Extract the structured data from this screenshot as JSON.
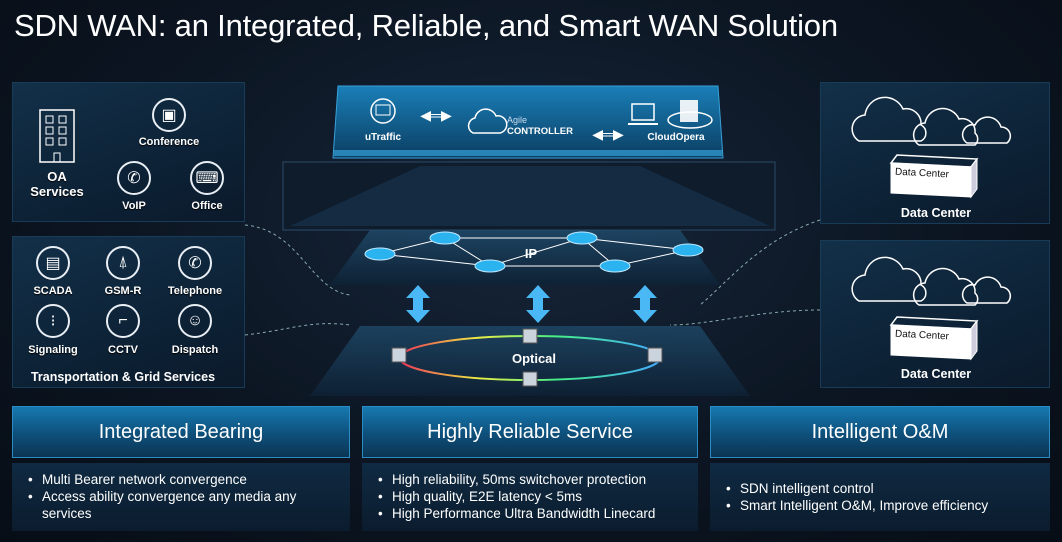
{
  "title": "SDN WAN: an Integrated, Reliable, and Smart WAN Solution",
  "oa": {
    "title_line1": "OA",
    "title_line2": "Services",
    "items": [
      {
        "label": "Conference",
        "icon": "conference-icon"
      },
      {
        "label": "VoIP",
        "icon": "phone-icon"
      },
      {
        "label": "Office",
        "icon": "computer-icon"
      }
    ]
  },
  "transport": {
    "title": "Transportation & Grid Services",
    "items": [
      {
        "label": "SCADA",
        "icon": "server-icon"
      },
      {
        "label": "GSM-R",
        "icon": "antenna-icon"
      },
      {
        "label": "Telephone",
        "icon": "phone-icon"
      },
      {
        "label": "Signaling",
        "icon": "traffic-light-icon"
      },
      {
        "label": "CCTV",
        "icon": "camera-icon"
      },
      {
        "label": "Dispatch",
        "icon": "officer-icon"
      }
    ]
  },
  "controller": {
    "utraffic": "uTraffic",
    "agile": "Agile",
    "controller": "CONTROLLER",
    "cloudopera": "CloudOpera"
  },
  "network": {
    "ip": "IP",
    "optical": "Optical"
  },
  "datacenters": [
    {
      "label": "Data Center",
      "box": "Data Center"
    },
    {
      "label": "Data Center",
      "box": "Data Center"
    }
  ],
  "features": [
    {
      "title": "Integrated Bearing",
      "bullets": [
        "Multi Bearer network convergence",
        "Access ability convergence any media any services"
      ]
    },
    {
      "title": "Highly Reliable Service",
      "bullets": [
        "High reliability, 50ms switchover protection",
        "High quality, E2E latency < 5ms",
        "High Performance Ultra Bandwidth Linecard"
      ]
    },
    {
      "title": "Intelligent O&M",
      "bullets": [
        "SDN intelligent control",
        "Smart Intelligent O&M, Improve efficiency"
      ]
    }
  ]
}
